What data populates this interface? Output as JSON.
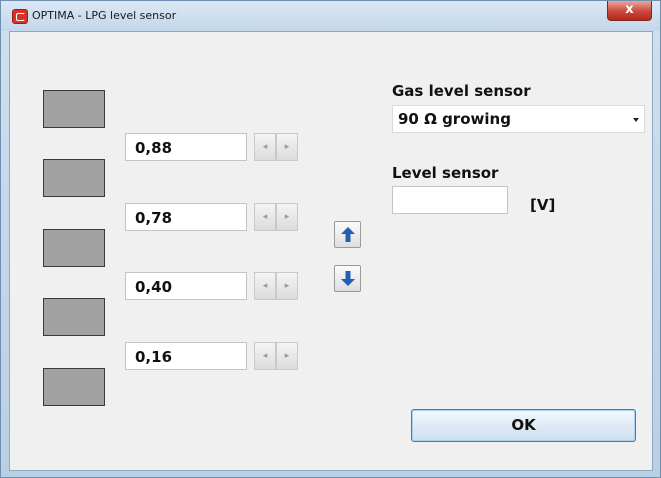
{
  "window": {
    "title": "OPTIMA - LPG level sensor",
    "close_label": "x"
  },
  "levels": {
    "values": [
      "0,88",
      "0,78",
      "0,40",
      "0,16"
    ],
    "spin_left": "◂",
    "spin_right": "▸",
    "swatch_color": "#a2a2a2"
  },
  "gas_level_sensor": {
    "label": "Gas level sensor",
    "selected": "90 Ω growing"
  },
  "level_sensor": {
    "label": "Level sensor",
    "value": "",
    "unit": "[V]"
  },
  "buttons": {
    "ok_label": "OK",
    "up_icon": "arrow-up-icon",
    "down_icon": "arrow-down-icon"
  },
  "colors": {
    "arrow_blue": "#1f5fb4",
    "close_red": "#c9473a"
  }
}
